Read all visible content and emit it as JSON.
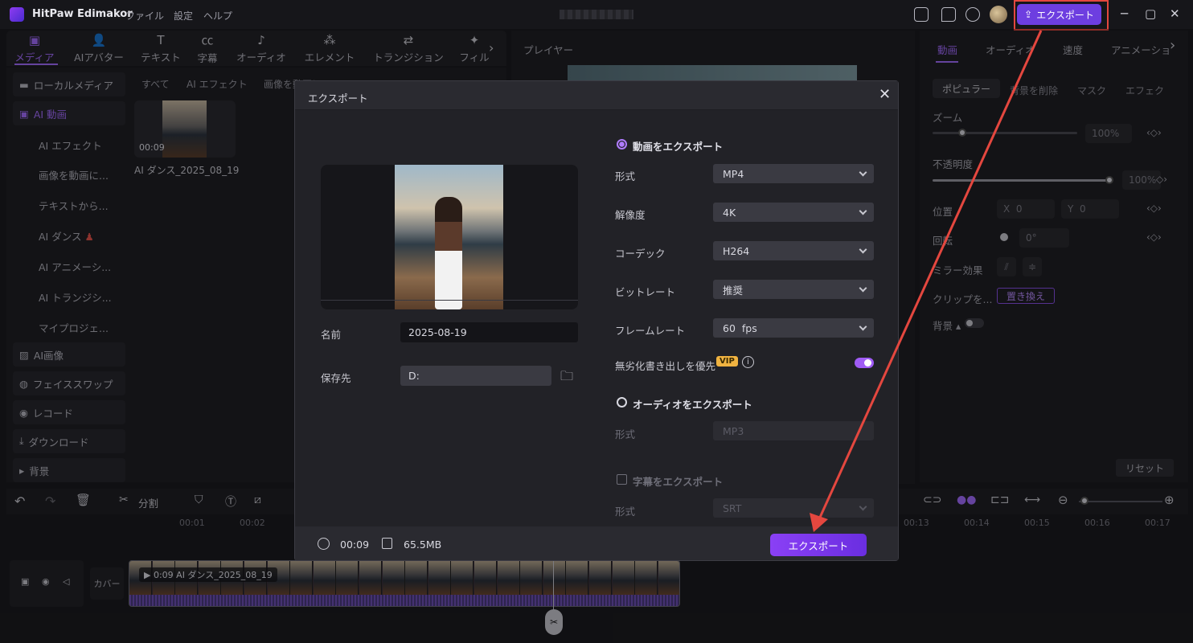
{
  "titlebar": {
    "app_name": "HitPaw Edimakor",
    "menu": [
      "ファイル",
      "設定",
      "ヘルプ"
    ],
    "export_label": "エクスポート"
  },
  "toolbar": {
    "tabs": [
      "メディア",
      "AIアバター",
      "テキスト",
      "字幕",
      "オーディオ",
      "エレメント",
      "トランジション",
      "フィル"
    ]
  },
  "sidebar": {
    "items": [
      "ローカルメディア",
      "AI 動画",
      "AI画像",
      "フェイススワップ",
      "レコード",
      "ダウンロード",
      "背景"
    ],
    "sub_items": [
      "AI エフェクト",
      "画像を動画に...",
      "テキストから...",
      "AI ダンス",
      "AI アニメーシ...",
      "AI トランジシ...",
      "マイプロジェ..."
    ]
  },
  "media": {
    "tabs": [
      "すべて",
      "AI エフェクト",
      "画像を動画に変換"
    ],
    "item": {
      "duration": "00:09",
      "name": "AI ダンス_2025_08_19"
    }
  },
  "player": {
    "title": "プレイヤー"
  },
  "right_panel": {
    "tabs": [
      "動画",
      "オーディオ",
      "速度",
      "アニメーショ"
    ],
    "subtabs": [
      "ポピュラー",
      "背景を削除",
      "マスク",
      "エフェク"
    ],
    "zoom_label": "ズーム",
    "zoom_value": "100%",
    "opacity_label": "不透明度",
    "opacity_value": "100%",
    "position_label": "位置",
    "pos_x_label": "X",
    "pos_x_value": "0",
    "pos_y_label": "Y",
    "pos_y_value": "0",
    "rotate_label": "回転",
    "rotate_value": "0°",
    "mirror_label": "ミラー効果",
    "clip_label": "クリップを...",
    "replace_label": "置き換え",
    "background_label": "背景",
    "reset_label": "リセット"
  },
  "timeline": {
    "split_label": "分割",
    "ruler_left": [
      "00:01",
      "00:02"
    ],
    "ruler_right": [
      "00:13",
      "00:14",
      "00:15",
      "00:16",
      "00:17"
    ],
    "cover_label": "カバー",
    "clip_label": "0:09 AI ダンス_2025_08_19"
  },
  "dialog": {
    "title": "エクスポート",
    "name_label": "名前",
    "name_value": "2025-08-19",
    "save_label": "保存先",
    "save_value": "D:",
    "video_export_label": "動画をエクスポート",
    "format_label": "形式",
    "format_value": "MP4",
    "resolution_label": "解像度",
    "resolution_value": "4K",
    "codec_label": "コーデック",
    "codec_value": "H264",
    "bitrate_label": "ビットレート",
    "bitrate_value": "推奨",
    "framerate_label": "フレームレート",
    "framerate_value": "60  fps",
    "lossless_label": "無劣化書き出しを優先",
    "vip_label": "VIP",
    "audio_export_label": "オーディオをエクスポート",
    "audio_format_label": "形式",
    "audio_format_value": "MP3",
    "subtitle_export_label": "字幕をエクスポート",
    "subtitle_format_label": "形式",
    "subtitle_format_value": "SRT",
    "duration": "00:09",
    "filesize": "65.5MB",
    "export_button": "エクスポート"
  },
  "colors": {
    "accent": "#8a40f5",
    "annotation": "#e4473f"
  }
}
